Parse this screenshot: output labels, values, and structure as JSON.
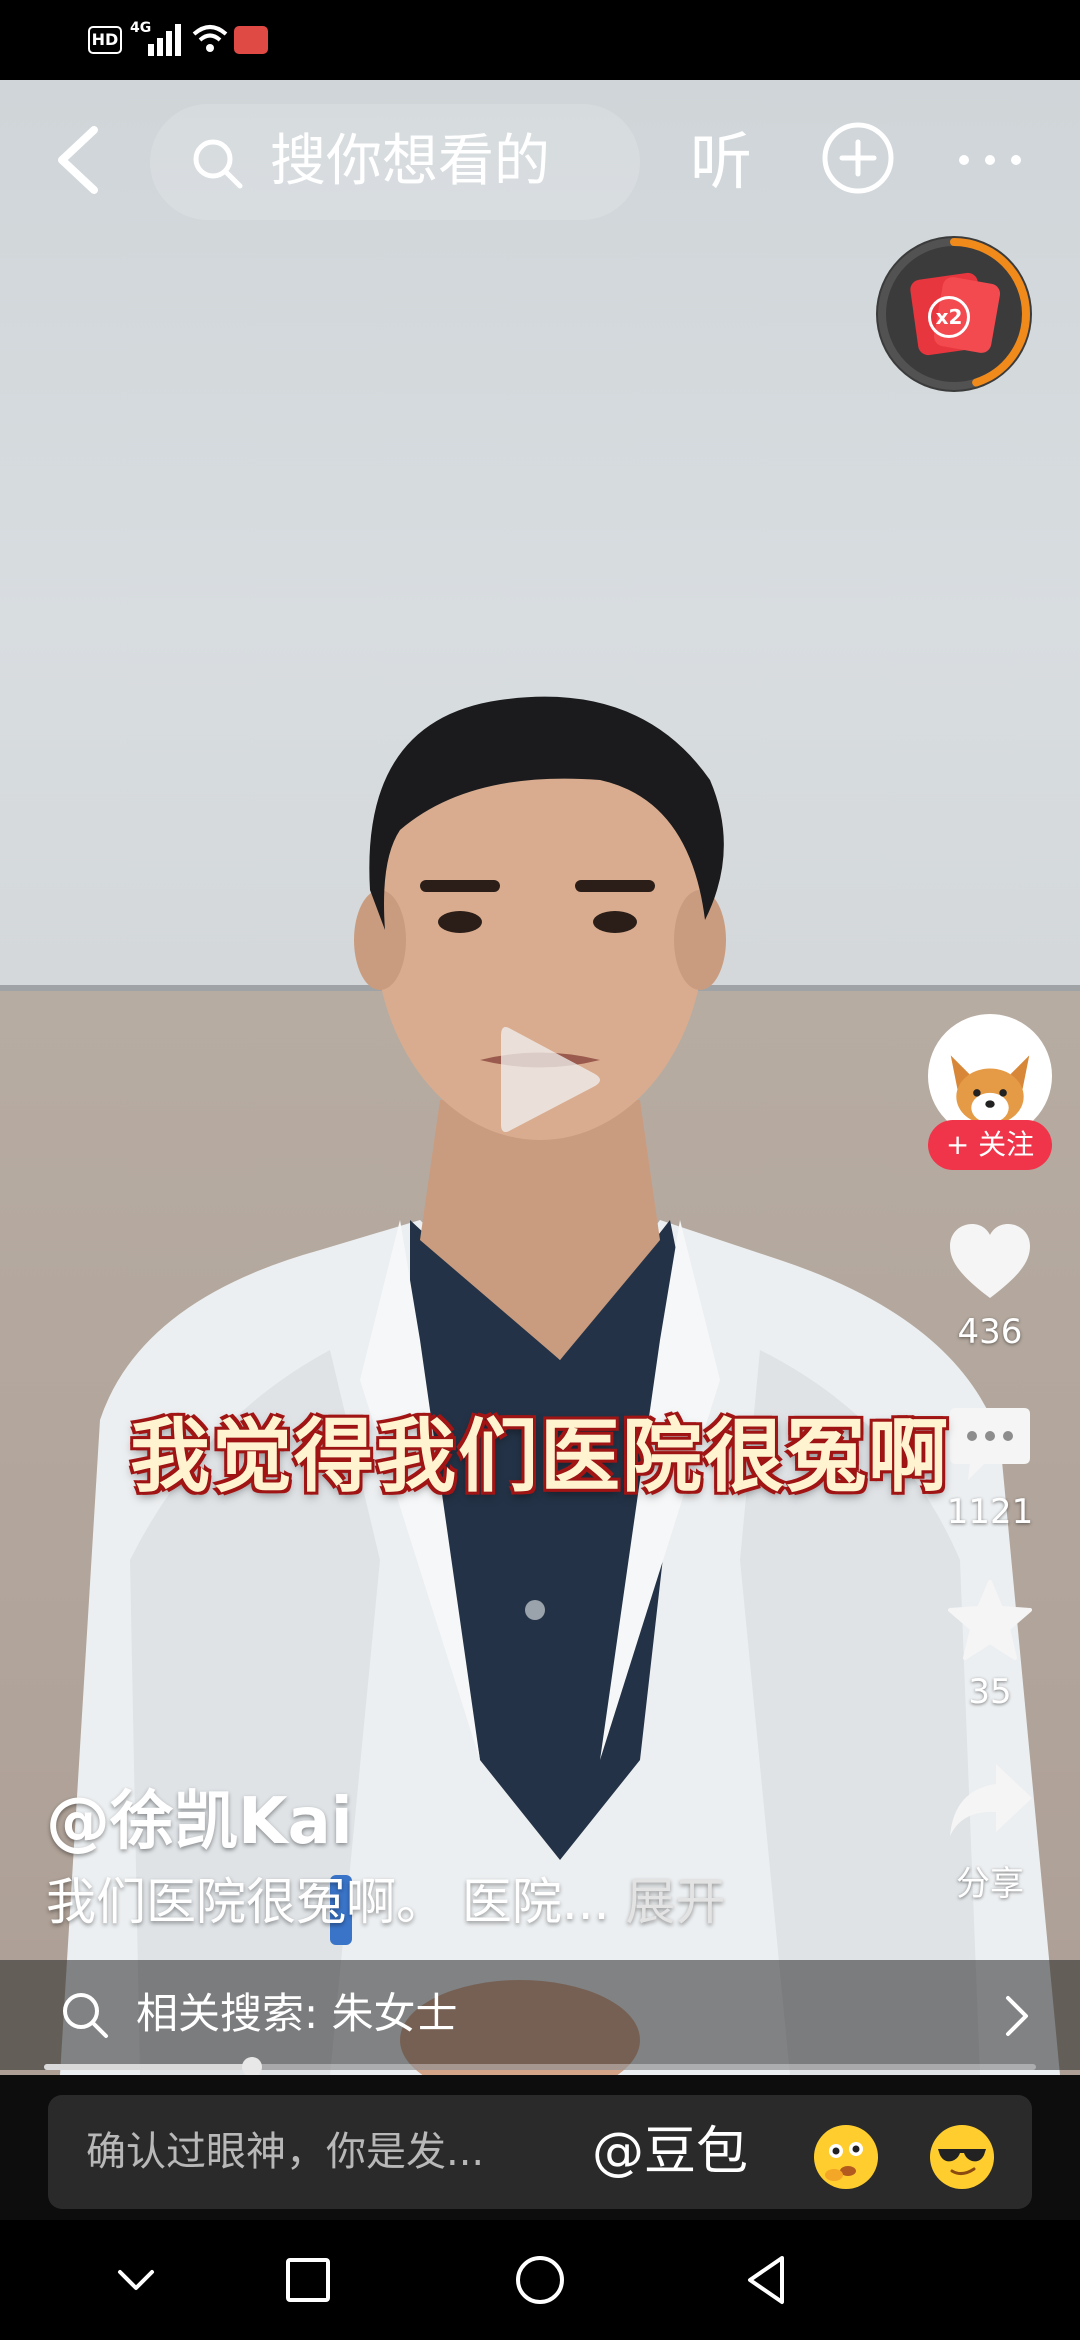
{
  "status_bar": {
    "hd_label": "HD",
    "network_label": "4G",
    "right_text": ""
  },
  "top_bar": {
    "search_placeholder": "搜你想看的",
    "listen_label": "听",
    "icons": [
      "back-arrow-icon",
      "search-icon",
      "plus-circle-icon",
      "more-dots-icon"
    ]
  },
  "reward": {
    "multiplier": "x2",
    "icon": "red-envelope-icon",
    "progress_fraction": 0.45,
    "ring_color": "#f08a1a"
  },
  "video": {
    "subtitle": "我觉得我们医院很冤啊",
    "author": "@徐凯Kai",
    "description": "我们医院很冤啊。 医院...",
    "expand_label": "展开",
    "playback_progress_fraction": 0.21
  },
  "actions": {
    "follow_label": "+ 关注",
    "likes": "436",
    "comments": "1121",
    "favorites": "35",
    "share_label": "分享"
  },
  "related_search": {
    "label": "相关搜索: 朱女士"
  },
  "comment_input": {
    "placeholder": "确认过眼神，你是发...",
    "mention": "@豆包",
    "emoji_icons": [
      "thinking-emoji-icon",
      "sunglasses-emoji-icon"
    ]
  },
  "nav_bar": {
    "icons": [
      "nav-down-icon",
      "nav-recents-icon",
      "nav-home-icon",
      "nav-back-icon"
    ]
  },
  "colors": {
    "accent_red": "#f0344a",
    "subtitle_fill": "#fff3d0",
    "subtitle_outline": "#a31515"
  }
}
